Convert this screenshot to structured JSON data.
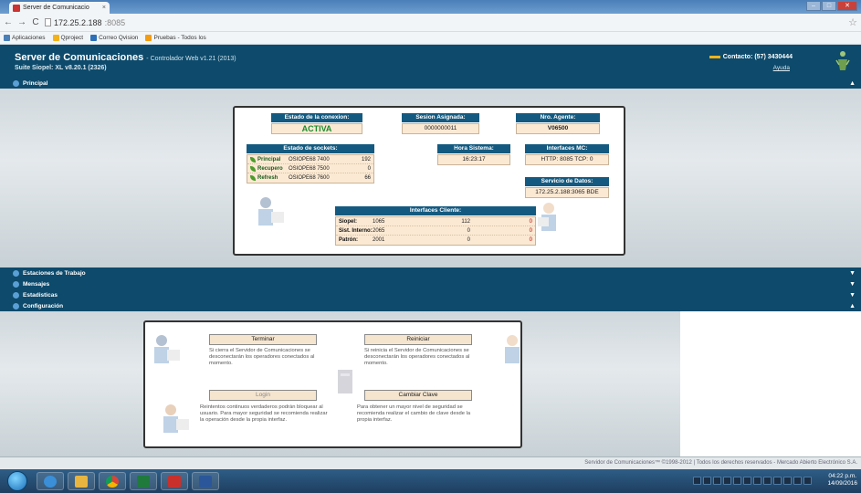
{
  "browser": {
    "tab_title": "Server de Comunicacio",
    "tab_close": "×",
    "url_host": "172.25.2.188",
    "url_port": ":8085",
    "bookmarks": [
      {
        "label": "Aplicaciones",
        "color": "#4a7fb8"
      },
      {
        "label": "Qproject",
        "color": "#f3b21a"
      },
      {
        "label": "Correo Qvision",
        "color": "#2c6fb8"
      },
      {
        "label": "Pruebas - Todos los",
        "color": "#f39c12"
      }
    ]
  },
  "header": {
    "title": "Server de Comunicaciones",
    "subtitle": "- Controlador Web v1.21 (2013)",
    "suite": "Suite Siopel: XL v8.20.1 (2326)",
    "contact": "Contacto: (57) 3430444",
    "help": "Ayuda"
  },
  "sections": {
    "principal": "Principal",
    "estaciones": "Estaciones de Trabajo",
    "mensajes": "Mensajes",
    "estadisticas": "Estadisticas",
    "configuracion": "Configuración"
  },
  "status": {
    "estado_conexion_label": "Estado de la conexion:",
    "estado_conexion_value": "ACTIVA",
    "sesion_label": "Sesion Asignada:",
    "sesion_value": "0000000011",
    "agente_label": "Nro. Agente:",
    "agente_value": "V06500",
    "sockets_label": "Estado de sockets:",
    "sockets": [
      {
        "name": "Principal",
        "host": "OSIOPE68 7400",
        "count": "192"
      },
      {
        "name": "Recupero",
        "host": "OSIOPE68 7500",
        "count": "0"
      },
      {
        "name": "Refresh",
        "host": "OSIOPE68 7600",
        "count": "66"
      }
    ],
    "hora_label": "Hora Sistema:",
    "hora_value": "16:23:17",
    "interfaces_mc_label": "Interfaces MC:",
    "interfaces_mc_value": "HTTP: 8085 TCP: 0",
    "servicio_label": "Servicio de Datos:",
    "servicio_value": "172.25.2.188:3065 BDE",
    "interfaces_cliente_label": "Interfaces Cliente:",
    "interfaces_cliente": [
      {
        "name": "Siopel:",
        "port": "1065",
        "a": "112",
        "b": "0"
      },
      {
        "name": "Sist. Interno:",
        "port": "2065",
        "a": "0",
        "b": "0"
      },
      {
        "name": "Patrón:",
        "port": "2001",
        "a": "0",
        "b": "0"
      }
    ]
  },
  "config": {
    "terminar_label": "Terminar",
    "terminar_text": "Si cierra el Servidor de Comunicaciones se desconectarán los operadores conectados al momento.",
    "reiniciar_label": "Reiniciar",
    "reiniciar_text": "Si reinicia el Servidor de Comunicaciones se desconectarán los operadores conectados al momento.",
    "login_label": "Login",
    "login_text": "Reintentos continuos verdaderos podrán bloquear al usuario. Para mayor seguridad se recomienda realizar la operación desde la propia interfaz.",
    "cambiar_label": "Cambiar Clave",
    "cambiar_text": "Para obtener un mayor nivel de seguridad se recomienda realizar el cambio de clave desde la propia interfaz."
  },
  "footer": "Servidor de Comunicaciones™ ©1998-2012 | Todos los derechos reservados - Mercado Abierto Electrónico S.A.",
  "taskbar": {
    "time": "04:22 p.m.",
    "date": "14/09/2016"
  }
}
